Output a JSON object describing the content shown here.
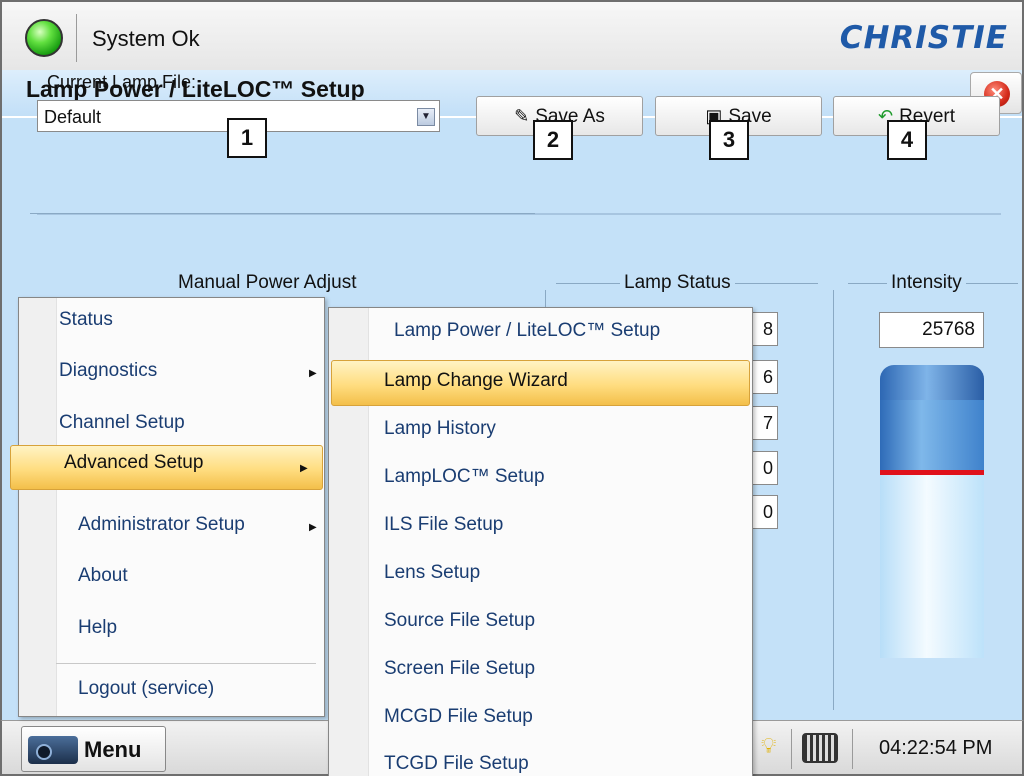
{
  "status": {
    "text": "System Ok",
    "led_color": "#2fc41c"
  },
  "brand": {
    "logo_text": "CHRISTIE"
  },
  "panel": {
    "title": "Lamp Power / LiteLOC™ Setup",
    "close_icon": "close-icon"
  },
  "lamp_file": {
    "label": "Current Lamp File:",
    "value": "Default"
  },
  "toolbar": {
    "save_as_label": "Save As",
    "save_label": "Save",
    "revert_label": "Revert"
  },
  "callouts": [
    "1",
    "2",
    "3",
    "4"
  ],
  "groups": {
    "manual_power": "Manual Power Adjust",
    "lamp_status": "Lamp Status",
    "intensity": "Intensity"
  },
  "intensity": {
    "value": "25768",
    "marker_color": "#e0111b"
  },
  "lamp_status_values": [
    "8",
    "6",
    "7",
    "0",
    "0"
  ],
  "main_menu": {
    "items": [
      "Status",
      "Diagnostics",
      "Channel Setup",
      "Advanced Setup",
      "Administrator Setup",
      "About",
      "Help",
      "Logout (service)"
    ],
    "selected": "Advanced Setup"
  },
  "submenu": {
    "header": "Lamp Power / LiteLOC™ Setup",
    "items": [
      "Lamp Change Wizard",
      "Lamp History",
      "LampLOC™ Setup",
      "ILS File Setup",
      "Lens Setup",
      "Source File Setup",
      "Screen File Setup",
      "MCGD File Setup",
      "TCGD File Setup"
    ],
    "selected": "Lamp Change Wizard"
  },
  "taskbar": {
    "menu_label": "Menu",
    "clock": "04:22:54 PM"
  },
  "colors": {
    "panel_bg": "#c4e1f8",
    "highlight": "#ffdd80",
    "menu_text": "#1a3d72",
    "brand": "#1f5aa8"
  }
}
